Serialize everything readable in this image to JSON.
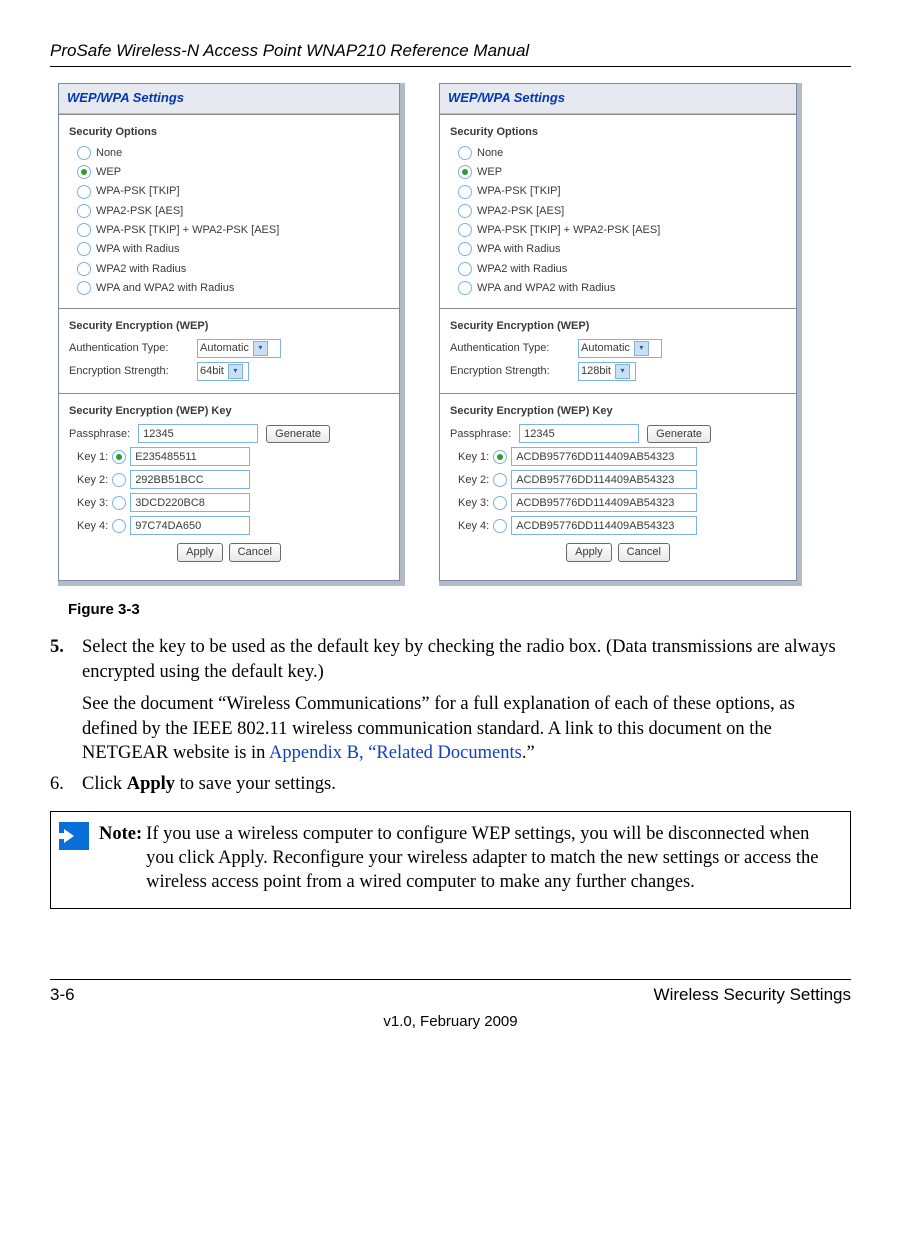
{
  "header": {
    "title": "ProSafe Wireless-N Access Point WNAP210 Reference Manual"
  },
  "figure": {
    "panel_title": "WEP/WPA Settings",
    "section": {
      "options": "Security Options",
      "wep": "Security Encryption (WEP)",
      "wepkey": "Security Encryption (WEP) Key"
    },
    "options": [
      "None",
      "WEP",
      "WPA-PSK [TKIP]",
      "WPA2-PSK [AES]",
      "WPA-PSK [TKIP] + WPA2-PSK [AES]",
      "WPA with Radius",
      "WPA2 with Radius",
      "WPA and WPA2 with Radius"
    ],
    "auth_label": "Authentication Type:",
    "auth_value": "Automatic",
    "enc_label": "Encryption Strength:",
    "passphrase_label": "Passphrase:",
    "passphrase_value": "12345",
    "generate_btn": "Generate",
    "apply_btn": "Apply",
    "cancel_btn": "Cancel",
    "key_labels": [
      "Key 1:",
      "Key 2:",
      "Key 3:",
      "Key 4:"
    ],
    "left": {
      "enc_strength": "64bit",
      "keys": [
        "E235485511",
        "292BB51BCC",
        "3DCD220BC8",
        "97C74DA650"
      ]
    },
    "right": {
      "enc_strength": "128bit",
      "keys": [
        "ACDB95776DD114409AB54323",
        "ACDB95776DD114409AB54323",
        "ACDB95776DD114409AB54323",
        "ACDB95776DD114409AB54323"
      ]
    },
    "caption": "Figure 3-3"
  },
  "body": {
    "step5_num": "5.",
    "step5_a": "Select the key to be used as the default key by checking the radio box. (Data transmissions are always encrypted using the default key.)",
    "step5_b_pre": "See the document “Wireless Communications” for a full explanation of each of these options, as defined by the IEEE 802.11 wireless communication standard. A link to this document on the NETGEAR website is in ",
    "step5_b_link": "Appendix B, “Related Documents",
    "step5_b_post": ".”",
    "step6_num": "6.",
    "step6_pre": "Click ",
    "step6_bold": "Apply",
    "step6_post": " to save your settings."
  },
  "note": {
    "label": "Note:",
    "text": " If you use a wireless computer to configure WEP settings, you will be disconnected when you click Apply. Reconfigure your wireless adapter to match the new settings or access the wireless access point from a wired computer to make any further changes."
  },
  "footer": {
    "page": "3-6",
    "section": "Wireless Security Settings",
    "version": "v1.0, February 2009"
  }
}
